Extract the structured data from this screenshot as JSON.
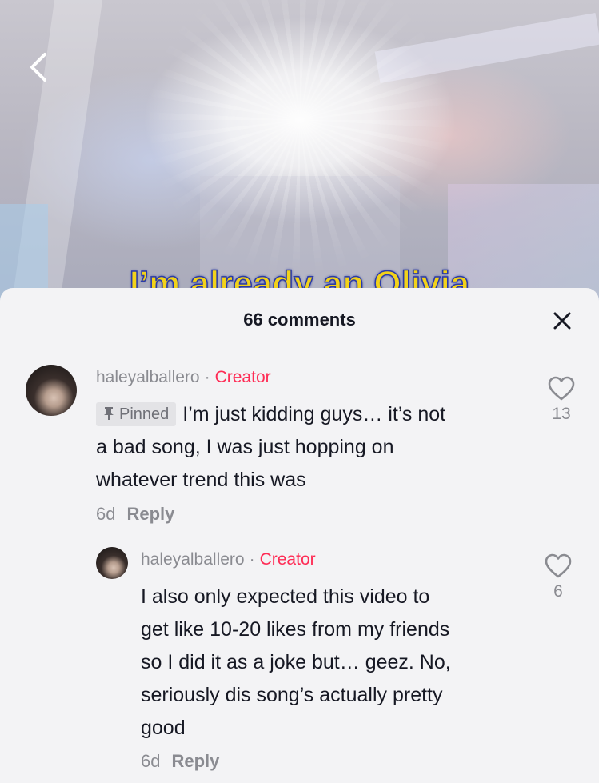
{
  "video": {
    "caption": "I’m already an Olivia"
  },
  "sheet": {
    "title": "66 comments"
  },
  "comments": [
    {
      "username": "haleyalballero",
      "badge": "Creator",
      "pinned_label": "Pinned",
      "text_lines": [
        "I’m just kidding guys… it’s not",
        "a bad song, I was just hopping on",
        "whatever trend this was"
      ],
      "time": "6d",
      "reply_label": "Reply",
      "likes": "13"
    },
    {
      "username": "haleyalballero",
      "badge": "Creator",
      "text_lines": [
        "I also only expected this video to",
        "get like 10-20 likes from my friends",
        "so I did it as a joke but… geez. No,",
        "seriously dis song’s actually pretty",
        "good"
      ],
      "time": "6d",
      "reply_label": "Reply",
      "likes": "6"
    }
  ],
  "icons": {
    "back": "chevron-left-icon",
    "close": "close-icon",
    "like": "heart-outline-icon",
    "pin": "pin-icon"
  },
  "colors": {
    "creator_badge": "#fe2c55",
    "caption_fill": "#f2d21a",
    "caption_outline": "#2a3aa8"
  }
}
